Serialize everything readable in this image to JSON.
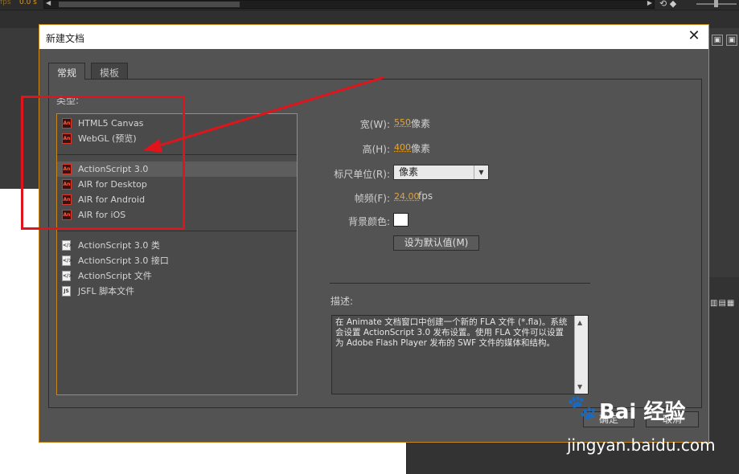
{
  "background": {
    "fps_label": "fps",
    "fps_value": "0.0 s",
    "scroll_left_arrow": "◀",
    "scroll_right_arrow": "▶",
    "panel_icons": "▥▤▦"
  },
  "dialog": {
    "title": "新建文档",
    "close_label": "✕",
    "tabs": [
      {
        "label": "常规"
      },
      {
        "label": "模板"
      }
    ],
    "type_label": "类型:",
    "type_groups": [
      [
        {
          "label": "HTML5 Canvas",
          "icon": "an-icon"
        },
        {
          "label": "WebGL (预览)",
          "icon": "an-icon"
        }
      ],
      [
        {
          "label": "ActionScript 3.0",
          "icon": "an-icon",
          "selected": true
        },
        {
          "label": "AIR for Desktop",
          "icon": "an-icon"
        },
        {
          "label": "AIR for Android",
          "icon": "an-icon"
        },
        {
          "label": "AIR for iOS",
          "icon": "an-icon"
        }
      ],
      [
        {
          "label": "ActionScript 3.0 类",
          "icon": "script-file-icon"
        },
        {
          "label": "ActionScript 3.0 接口",
          "icon": "script-file-icon"
        },
        {
          "label": "ActionScript 文件",
          "icon": "script-file-icon"
        },
        {
          "label": "JSFL 脚本文件",
          "icon": "jsfl-file-icon"
        }
      ]
    ],
    "properties": {
      "width_label": "宽(W):",
      "width_value": "550",
      "width_unit": "像素",
      "height_label": "高(H):",
      "height_value": "400",
      "height_unit": "像素",
      "ruler_label": "标尺单位(R):",
      "ruler_value": "像素",
      "fps_label": "帧频(F):",
      "fps_value": "24.00",
      "fps_unit": "fps",
      "bgcolor_label": "背景颜色:",
      "bgcolor_value": "#ffffff",
      "default_button": "设为默认值(M)"
    },
    "description_label": "描述:",
    "description_text": "在 Animate 文档窗口中创建一个新的 FLA 文件 (*.fla)。系统会设置 ActionScript 3.0 发布设置。使用 FLA 文件可以设置为 Adobe Flash Player 发布的 SWF 文件的媒体和结构。",
    "ok_button": "确定",
    "cancel_button": "取消"
  },
  "watermark": {
    "brand": "Bai 经验",
    "url": "jingyan.baidu.com"
  },
  "colors": {
    "accent_orange": "#c9861c",
    "annotation_red": "#e0141a"
  }
}
